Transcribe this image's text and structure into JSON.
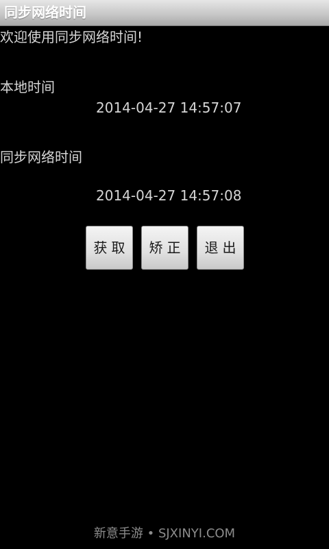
{
  "app": {
    "title": "同步网络时间"
  },
  "main": {
    "welcome_text": "欢迎使用同步网络时间!",
    "local_time_label": "本地时间",
    "local_time_value": "2014-04-27 14:57:07",
    "sync_time_label": "同步网络时间",
    "sync_time_value": "2014-04-27 14:57:08"
  },
  "buttons": {
    "get_label": "获取",
    "fix_label": "矫正",
    "exit_label": "退出"
  },
  "footer": {
    "watermark": "新意手游 • SJXINYI.COM"
  },
  "colors": {
    "background": "#000000",
    "text": "#d6d6d6",
    "titlebar": "#c8c8c8",
    "button": "#e0e0e0"
  }
}
